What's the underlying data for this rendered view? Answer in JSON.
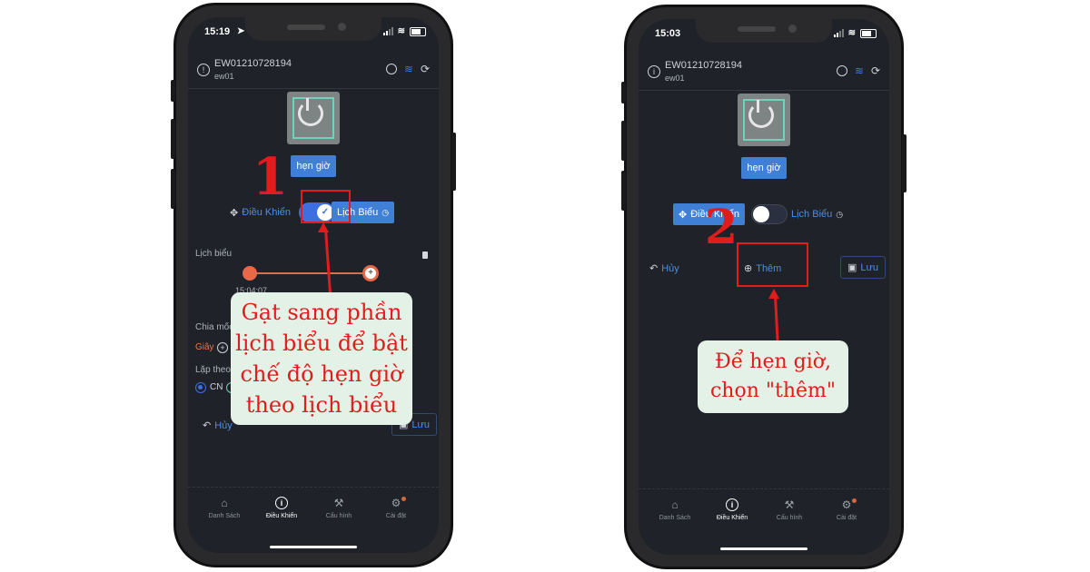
{
  "phones": [
    {
      "status_time": "15:19",
      "device_id": "EW01210728194",
      "device_name": "ew01",
      "timer_button": "hẹn giờ",
      "mode_control_label": "Điều Khiển",
      "mode_schedule_label": "Lịch Biểu",
      "toggle_state": "on",
      "schedule_section_title": "Lịch biểu",
      "timeline_start_time": "15:04:07",
      "timeline_add_label": "Thêm",
      "divide_label": "Chia mốc",
      "seconds_label": "Giây",
      "repeat_label": "Lặp theo",
      "repeat_selected": "CN",
      "cancel_label": "Hủy",
      "save_label": "Lưu",
      "step_number": "1",
      "callout_text": "Gạt sang phần lịch biểu để bật chế độ hẹn giờ theo lịch biểu"
    },
    {
      "status_time": "15:03",
      "device_id": "EW01210728194",
      "device_name": "ew01",
      "timer_button": "hẹn giờ",
      "mode_control_label": "Điều Khiển",
      "mode_schedule_label": "Lịch Biểu",
      "toggle_state": "off",
      "cancel_label": "Hủy",
      "add_label": "Thêm",
      "save_label": "Lưu",
      "step_number": "2",
      "callout_text": "Để hẹn giờ, chọn \"thêm\""
    }
  ],
  "tabbar": {
    "items": [
      {
        "label": "Danh Sách",
        "icon": "home-icon"
      },
      {
        "label": "Điều Khiển",
        "icon": "info-icon",
        "active": true
      },
      {
        "label": "Cấu hình",
        "icon": "wrench-icon"
      },
      {
        "label": "Cài đặt",
        "icon": "gear-icon",
        "badge": true
      }
    ]
  },
  "colors": {
    "accent_blue": "#3f80d6",
    "annotation_red": "#e11c1c",
    "callout_bg": "#e3f1e6",
    "screen_bg": "#1f2228",
    "timeline_orange": "#e8694a"
  }
}
